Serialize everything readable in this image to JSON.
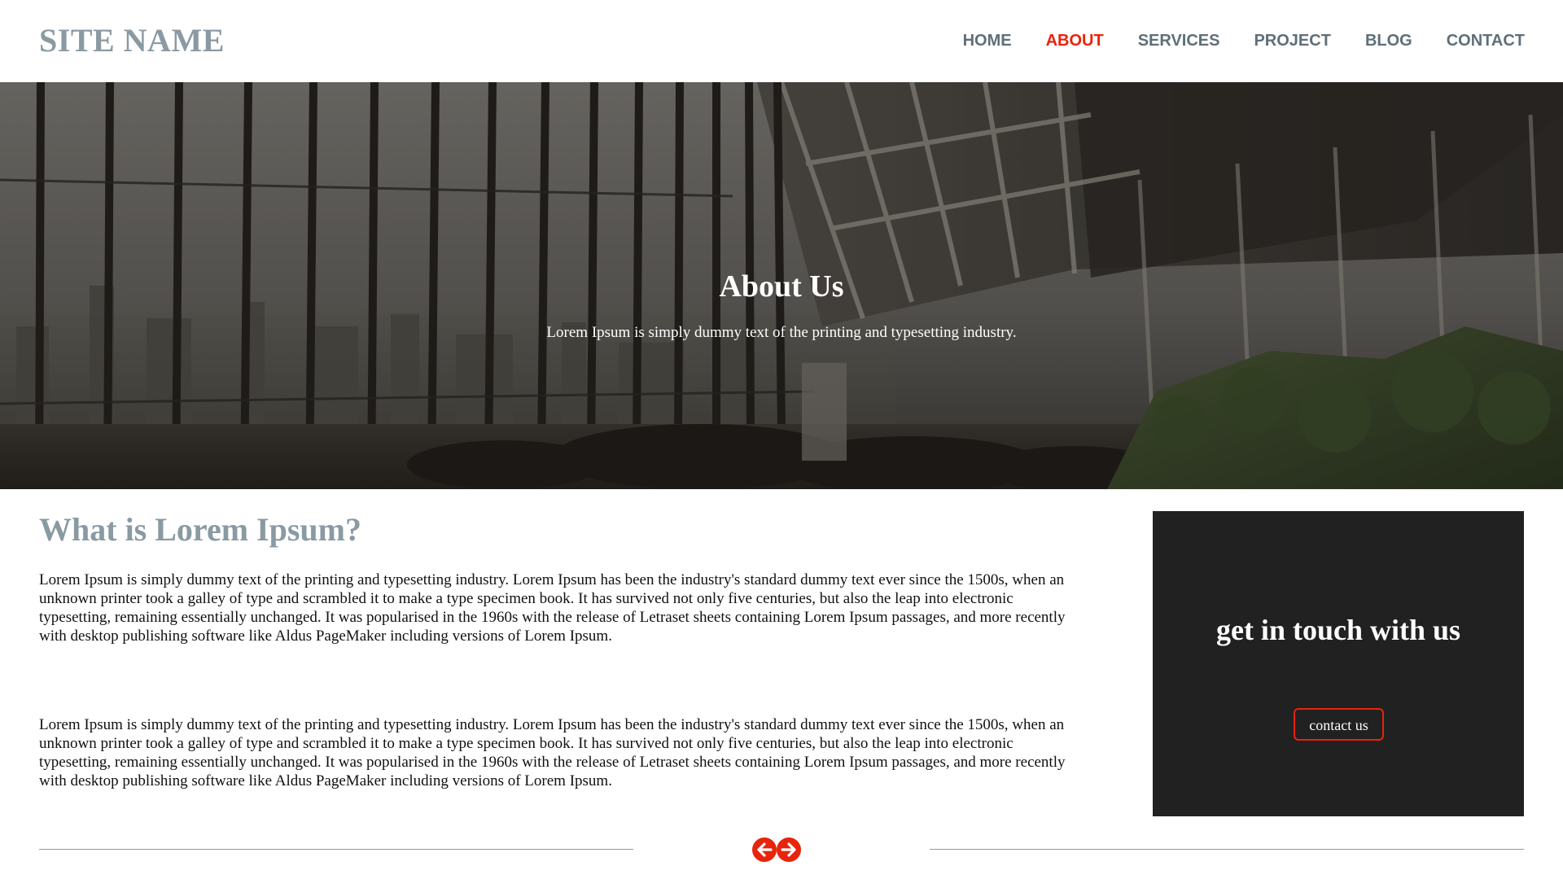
{
  "header": {
    "site_name": "SITE NAME",
    "nav": [
      {
        "label": "HOME",
        "active": false
      },
      {
        "label": "ABOUT",
        "active": true
      },
      {
        "label": "SERVICES",
        "active": false
      },
      {
        "label": "PROJECT",
        "active": false
      },
      {
        "label": "BLOG",
        "active": false
      },
      {
        "label": "CONTACT",
        "active": false
      }
    ]
  },
  "hero": {
    "title": "About Us",
    "subtitle": "Lorem Ipsum is simply dummy text of the printing and typesetting industry."
  },
  "main": {
    "heading": "What is Lorem Ipsum?",
    "paragraphs": [
      "Lorem Ipsum is simply dummy text of the printing and typesetting industry. Lorem Ipsum has been the industry's standard dummy text ever since the 1500s, when an unknown printer took a galley of type and scrambled it to make a type specimen book. It has survived not only five centuries, but also the leap into electronic typesetting, remaining essentially unchanged. It was popularised in the 1960s with the release of Letraset sheets containing Lorem Ipsum passages, and more recently with desktop publishing software like Aldus PageMaker including versions of Lorem Ipsum.",
      "Lorem Ipsum is simply dummy text of the printing and typesetting industry. Lorem Ipsum has been the industry's standard dummy text ever since the 1500s, when an unknown printer took a galley of type and scrambled it to make a type specimen book. It has survived not only five centuries, but also the leap into electronic typesetting, remaining essentially unchanged. It was popularised in the 1960s with the release of Letraset sheets containing Lorem Ipsum passages, and more recently with desktop publishing software like Aldus PageMaker including versions of Lorem Ipsum."
    ]
  },
  "sidebar": {
    "contact_title": "get in touch with us",
    "contact_button": "contact us"
  },
  "pager": {
    "prev_icon": "arrow-left-circle-icon",
    "next_icon": "arrow-right-circle-icon"
  },
  "colors": {
    "accent": "#e8240c",
    "brand_gray": "#8a9aa3",
    "nav_gray": "#5f6f78",
    "contact_bg": "#212121"
  }
}
